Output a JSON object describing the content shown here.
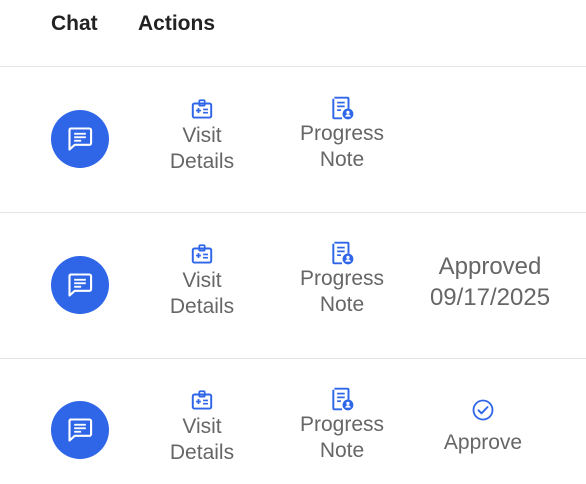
{
  "columns": {
    "chat": "Chat",
    "actions": "Actions"
  },
  "rows": [
    {
      "visit_line1": "Visit",
      "visit_line2": "Details",
      "progress_line1": "Progress",
      "progress_line2": "Note",
      "status": null
    },
    {
      "visit_line1": "Visit",
      "visit_line2": "Details",
      "progress_line1": "Progress",
      "progress_line2": "Note",
      "status_line1": "Approved",
      "status_line2": "09/17/2025"
    },
    {
      "visit_line1": "Visit",
      "visit_line2": "Details",
      "progress_line1": "Progress",
      "progress_line2": "Note",
      "approve_label": "Approve"
    }
  ],
  "icons": {
    "chat": "chat-bubble-icon",
    "visit": "id-badge-medical-icon",
    "progress": "note-person-icon",
    "approve": "check-circle-icon"
  },
  "colors": {
    "accent": "#2f66e8",
    "label": "#666666",
    "header": "#222222",
    "divider": "#e4e4e4"
  }
}
